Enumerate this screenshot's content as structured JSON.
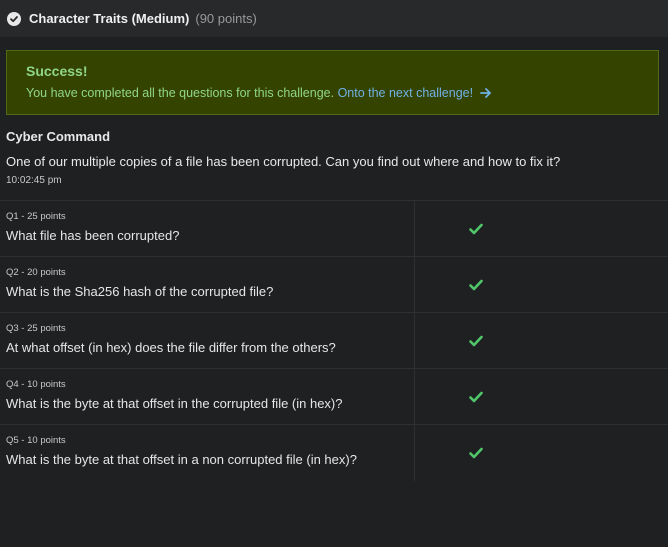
{
  "header": {
    "title": "Character Traits (Medium)",
    "points": "(90 points)"
  },
  "alert": {
    "title": "Success!",
    "message": "You have completed all the questions for this challenge.",
    "link": "Onto the next challenge!"
  },
  "challenge": {
    "author": "Cyber Command",
    "description": "One of our multiple copies of a file has been corrupted. Can you find out where and how to fix it?",
    "time": "10:02:45 pm"
  },
  "questions": [
    {
      "meta": "Q1 - 25 points",
      "text": "What file has been corrupted?",
      "status": "check-icon"
    },
    {
      "meta": "Q2 - 20 points",
      "text": "What is the Sha256 hash of the corrupted file?",
      "status": "check-icon"
    },
    {
      "meta": "Q3 - 25 points",
      "text": "At what offset (in hex) does the file differ from the others?",
      "status": "check-icon"
    },
    {
      "meta": "Q4 - 10 points",
      "text": "What is the byte at that offset in the corrupted file (in hex)?",
      "status": "check-icon"
    },
    {
      "meta": "Q5 - 10 points",
      "text": "What is the byte at that offset in a non corrupted file (in hex)?",
      "status": "check-icon"
    }
  ],
  "colors": {
    "success_text": "#8fd68a",
    "alert_bg": "#354300",
    "link": "#6fb2e6",
    "check": "#4fc76a"
  }
}
